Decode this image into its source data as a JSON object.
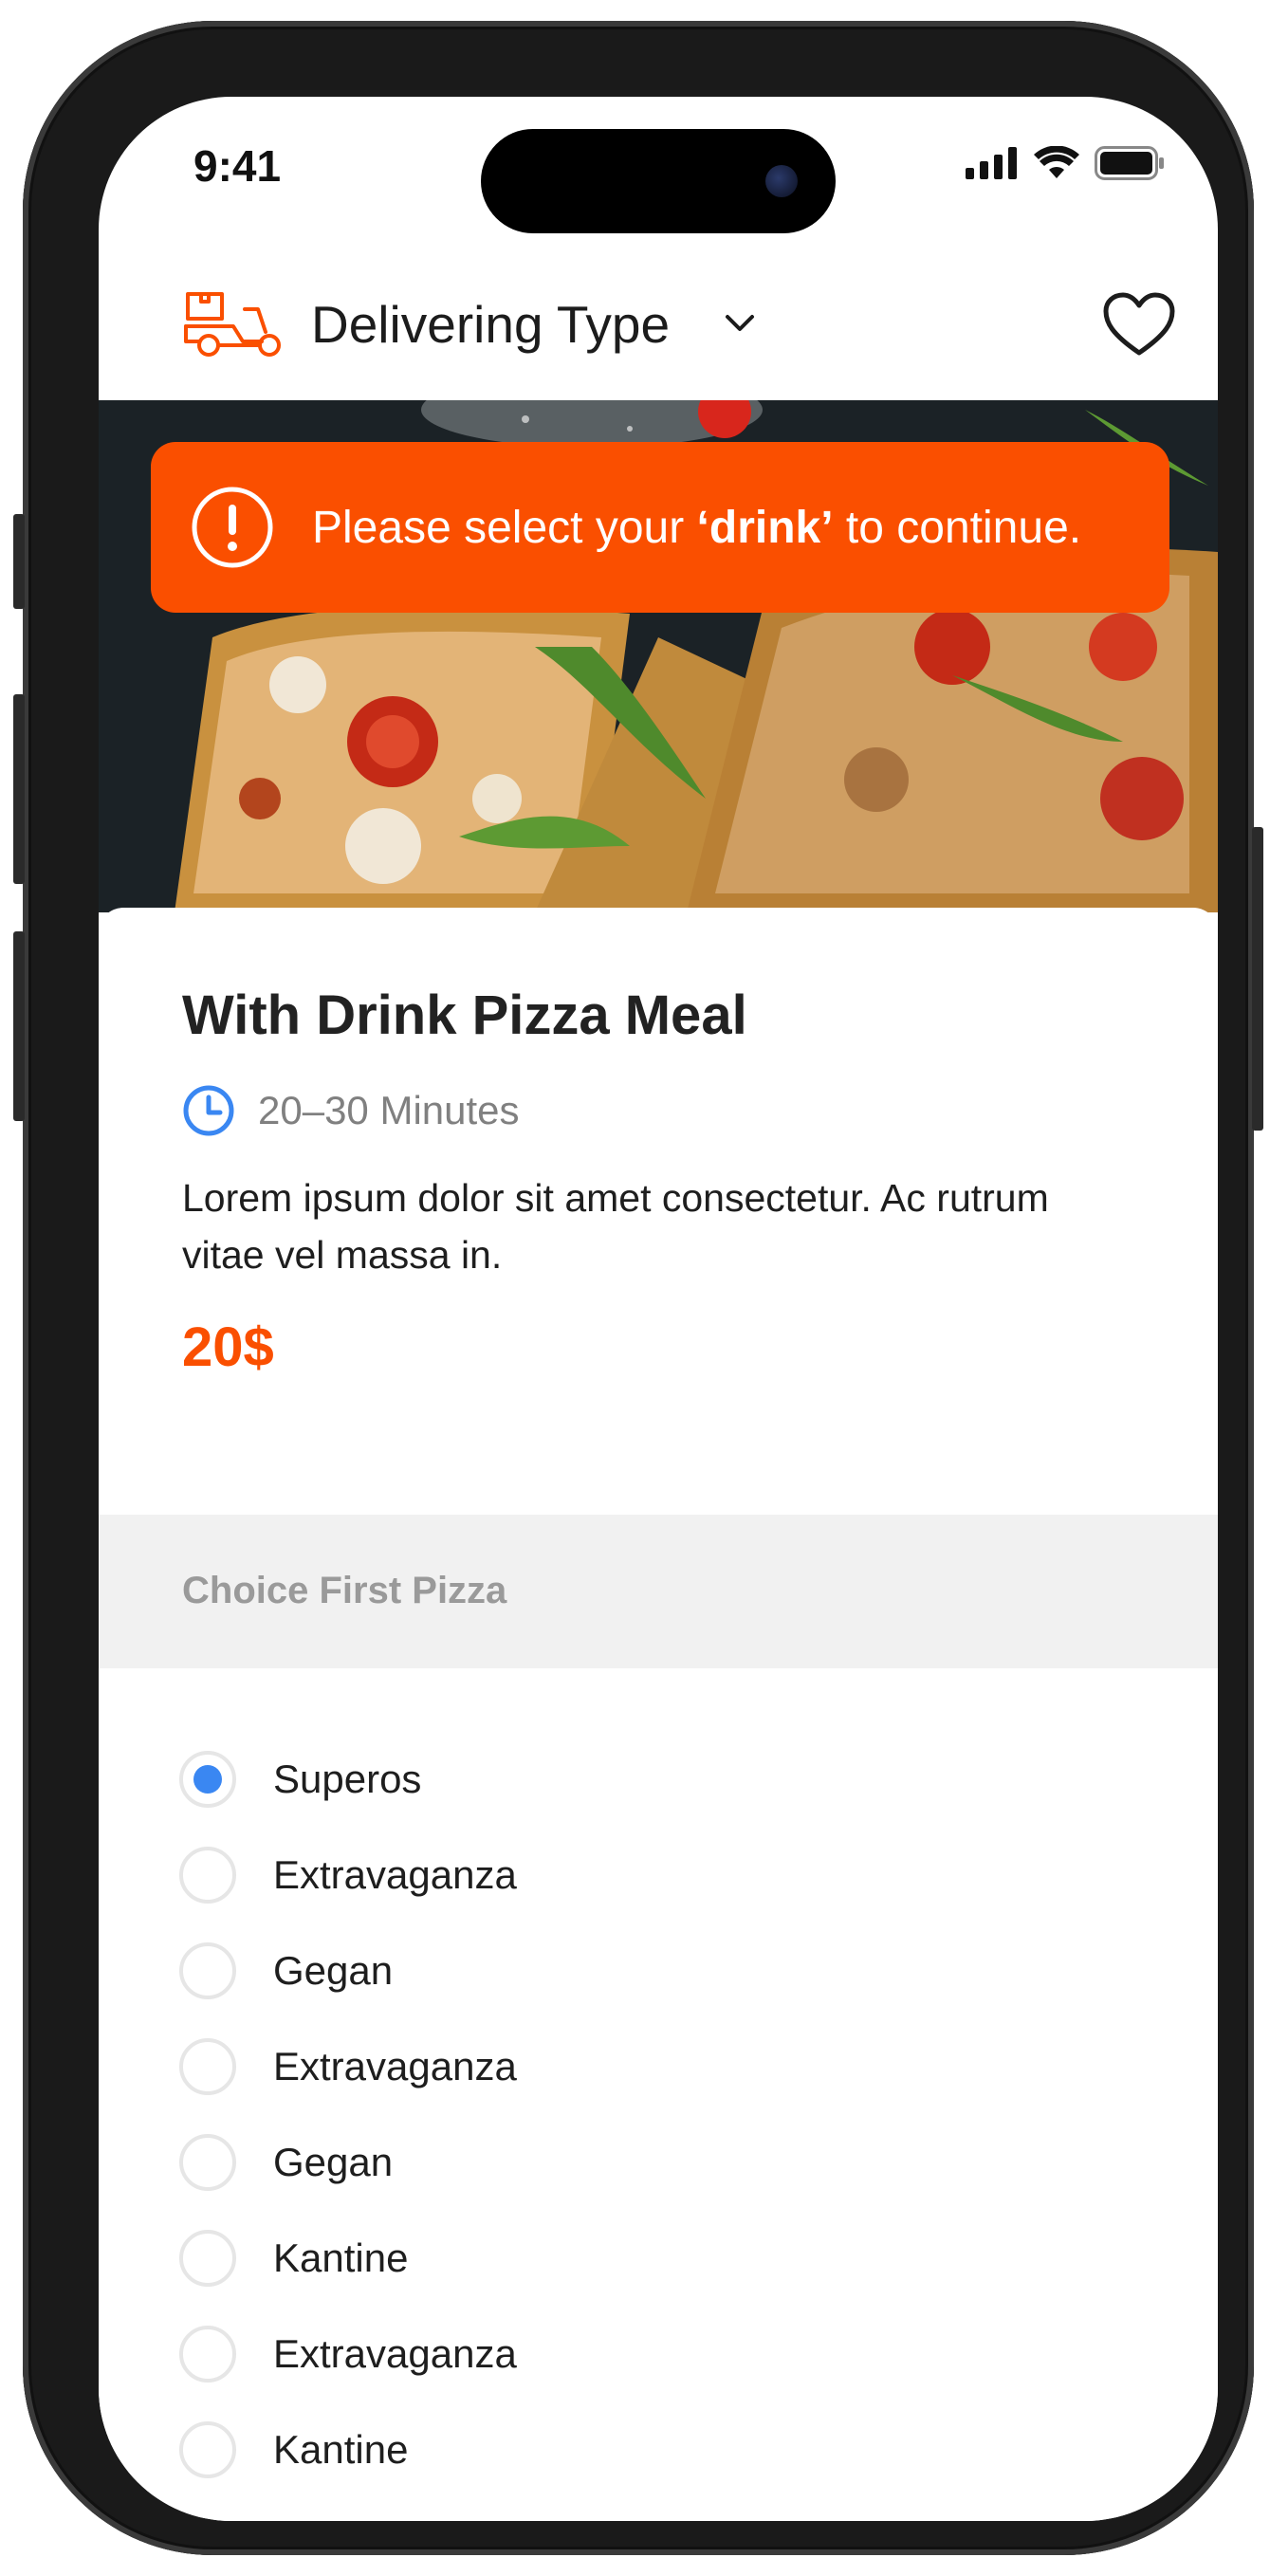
{
  "status_bar": {
    "time": "9:41"
  },
  "header": {
    "delivery_label": "Delivering Type"
  },
  "alert": {
    "text_before": "Please select your ",
    "text_bold": "‘drink’",
    "text_after": " to continue."
  },
  "product": {
    "title": "With Drink Pizza Meal",
    "duration": "20–30 Minutes",
    "description": "Lorem ipsum dolor sit amet consectetur. Ac rutrum vitae vel massa in.",
    "price": "20$"
  },
  "section": {
    "label": "Choice First Pizza",
    "options": [
      {
        "label": "Superos",
        "selected": true
      },
      {
        "label": "Extravaganza",
        "selected": false
      },
      {
        "label": "Gegan",
        "selected": false
      },
      {
        "label": "Extravaganza",
        "selected": false
      },
      {
        "label": "Gegan",
        "selected": false
      },
      {
        "label": "Kantine",
        "selected": false
      },
      {
        "label": "Extravaganza",
        "selected": false
      },
      {
        "label": "Kantine",
        "selected": false
      }
    ]
  },
  "colors": {
    "accent": "#fa4f00",
    "radio_selected": "#3a87f2",
    "clock_icon": "#3a87f2"
  }
}
